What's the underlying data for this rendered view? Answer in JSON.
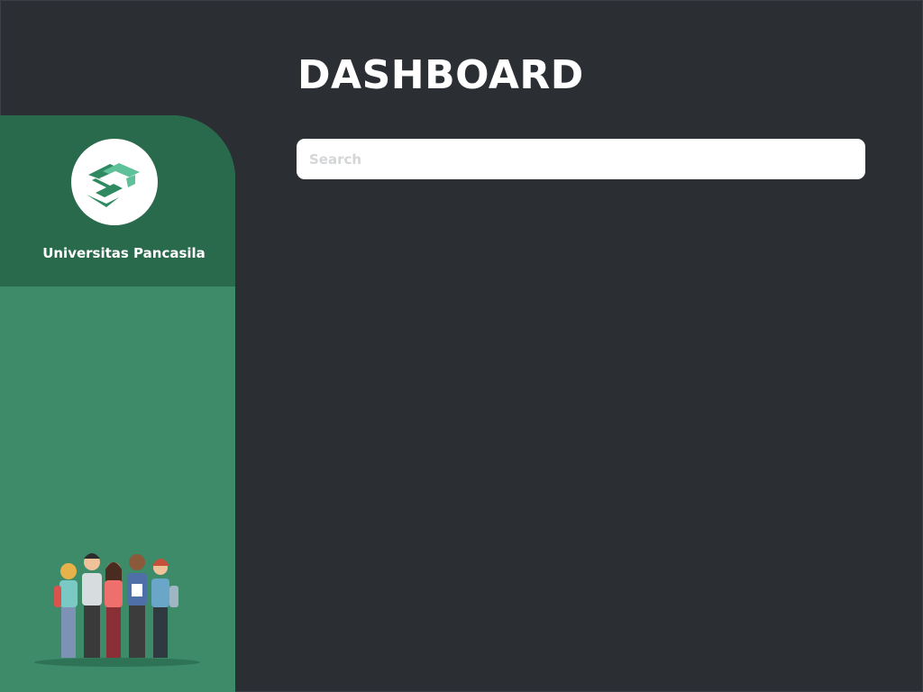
{
  "header": {
    "title": "DASHBOARD"
  },
  "search": {
    "placeholder": "Search",
    "value": ""
  },
  "sidebar": {
    "university_name": "Universitas Pancasila"
  },
  "colors": {
    "background": "#2b2e33",
    "sidebar": "#3e8b69",
    "sidebar_header": "#2a6a4c",
    "search_bg": "#ffffff"
  }
}
